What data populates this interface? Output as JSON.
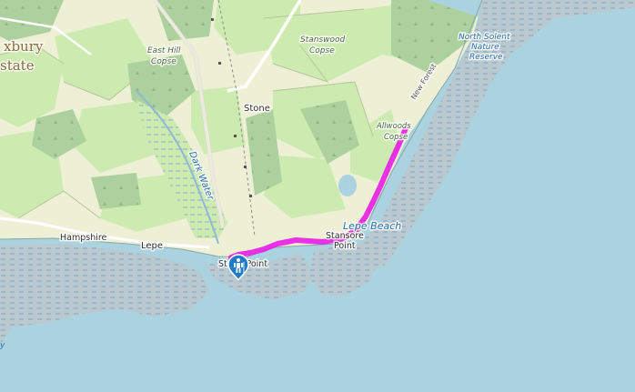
{
  "map": {
    "labels": {
      "estate_line1": "xbury",
      "estate_line2": "state",
      "east_hill_1": "East Hill",
      "east_hill_2": "Copse",
      "stanswood_1": "Stanswood",
      "stanswood_2": "Copse",
      "reserve_1": "North Solent",
      "reserve_2": "Nature",
      "reserve_3": "Reserve",
      "new_forest": "New Forest",
      "allwoods_1": "Allwoods",
      "allwoods_2": "Copse",
      "stone": "Stone",
      "dark_water": "Dark Water",
      "lepe_beach": "Lepe Beach",
      "stansore_1": "Stansore",
      "stansore_2": "Point",
      "hampshire": "Hampshire",
      "lepe": "Lepe",
      "stone_point": "Stone Point",
      "edge_y": "y"
    },
    "colors": {
      "sea": "#aad3df",
      "farmland": "#eef0d5",
      "grass": "#cdebb0",
      "wood": "#add19e",
      "mudflat": "#b5d0d0",
      "route": "#e81ce8"
    },
    "marker": {
      "icon": "hiker-icon",
      "color": "#1f7ac7"
    }
  }
}
